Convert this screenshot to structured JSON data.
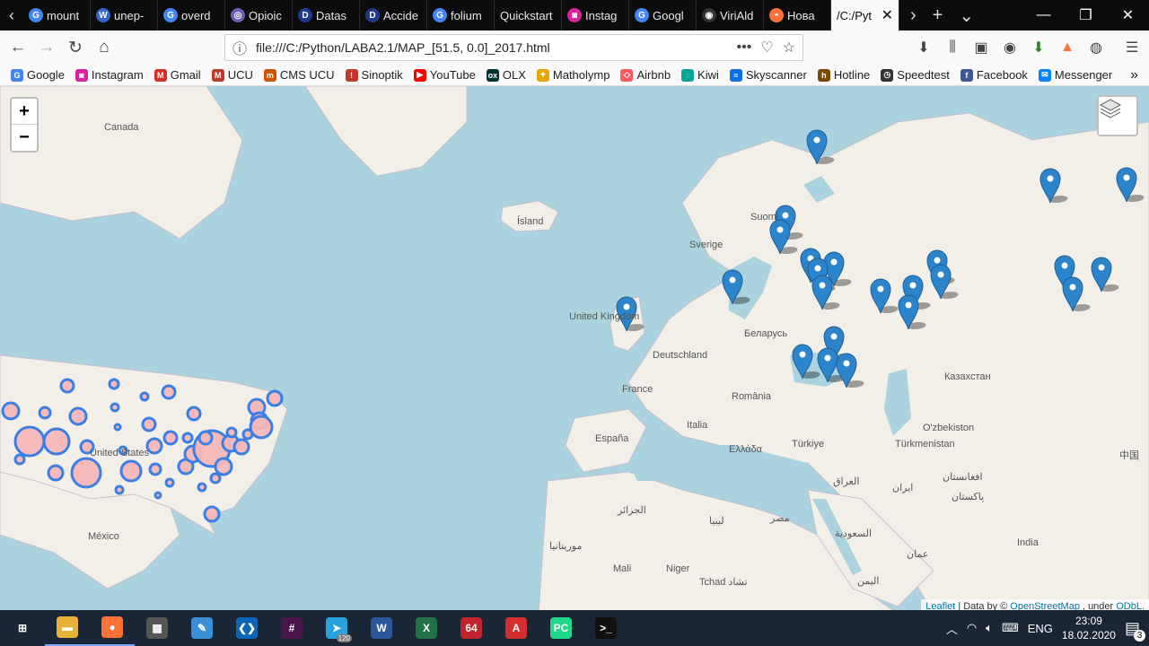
{
  "tabs": [
    {
      "icon": "G",
      "color": "#4285f4",
      "label": "mount"
    },
    {
      "icon": "W",
      "color": "#3366cc",
      "label": "unep-"
    },
    {
      "icon": "G",
      "color": "#4285f4",
      "label": "overd"
    },
    {
      "icon": "◎",
      "color": "#6b5fb5",
      "label": "Opioic"
    },
    {
      "icon": "D",
      "color": "#1f3a8a",
      "label": "Datas"
    },
    {
      "icon": "D",
      "color": "#1f3a8a",
      "label": "Accide"
    },
    {
      "icon": "G",
      "color": "#4285f4",
      "label": "folium"
    },
    {
      "icon": "",
      "color": "#0c0c0d",
      "label": "Quickstart"
    },
    {
      "icon": "◙",
      "color": "#d6249f",
      "label": "Instag"
    },
    {
      "icon": "G",
      "color": "#4285f4",
      "label": "Googl"
    },
    {
      "icon": "◉",
      "color": "#333",
      "label": "ViriAld"
    },
    {
      "icon": "◓",
      "color": "#ff7139",
      "label": "Нова"
    }
  ],
  "active_tab": {
    "label": "/C:/Pyt"
  },
  "url": "file:///C:/Python/LABA2.1/MAP_[51.5, 0.0]_2017.html",
  "bookmarks": [
    {
      "icon": "G",
      "color": "#4285f4",
      "label": "Google"
    },
    {
      "icon": "◙",
      "color": "#d6249f",
      "label": "Instagram"
    },
    {
      "icon": "M",
      "color": "#d93025",
      "label": "Gmail"
    },
    {
      "icon": "M",
      "color": "#c0392b",
      "label": "UCU"
    },
    {
      "icon": "m",
      "color": "#d35400",
      "label": "CMS UCU"
    },
    {
      "icon": "!",
      "color": "#c0392b",
      "label": "Sinoptik"
    },
    {
      "icon": "▶",
      "color": "#ff0000",
      "label": "YouTube"
    },
    {
      "icon": "ox",
      "color": "#002f34",
      "label": "OLX"
    },
    {
      "icon": "✦",
      "color": "#e6a800",
      "label": "Matholymp"
    },
    {
      "icon": "◇",
      "color": "#ff5a5f",
      "label": "Airbnb"
    },
    {
      "icon": "◌",
      "color": "#00a698",
      "label": "Kiwi"
    },
    {
      "icon": "≈",
      "color": "#0770e3",
      "label": "Skyscanner"
    },
    {
      "icon": "h",
      "color": "#7a4a00",
      "label": "Hotline"
    },
    {
      "icon": "◷",
      "color": "#333",
      "label": "Speedtest"
    },
    {
      "icon": "f",
      "color": "#3b5998",
      "label": "Facebook"
    },
    {
      "icon": "✉",
      "color": "#0084ff",
      "label": "Messenger"
    }
  ],
  "map": {
    "labels": [
      {
        "text": "Canada"
      },
      {
        "text": "Ísland"
      },
      {
        "text": "Suomi"
      },
      {
        "text": "Sverige"
      },
      {
        "text": "United Kingdom"
      },
      {
        "text": "Deutschland"
      },
      {
        "text": "Беларусь"
      },
      {
        "text": "France"
      },
      {
        "text": "România"
      },
      {
        "text": "Italia"
      },
      {
        "text": "España"
      },
      {
        "text": "Ελλάδα"
      },
      {
        "text": "Türkiye"
      },
      {
        "text": "Казахстан"
      },
      {
        "text": "O'zbekiston"
      },
      {
        "text": "Türkmenistan"
      },
      {
        "text": "United States"
      },
      {
        "text": "México"
      },
      {
        "text": "العراق"
      },
      {
        "text": "ایران"
      },
      {
        "text": "افغانستان"
      },
      {
        "text": "پاکستان"
      },
      {
        "text": "India"
      },
      {
        "text": "中国"
      },
      {
        "text": "الجزائر"
      },
      {
        "text": "ليبيا"
      },
      {
        "text": "مصر"
      },
      {
        "text": "السعودية"
      },
      {
        "text": "عمان"
      },
      {
        "text": "اليمن"
      },
      {
        "text": "Mali"
      },
      {
        "text": "Niger"
      },
      {
        "text": "Tchad تشاد"
      },
      {
        "text": "موريتانيا"
      }
    ],
    "zoom_in": "+",
    "zoom_out": "−",
    "attribution": {
      "leaflet": "Leaflet",
      "sep": "| Data by ©",
      "osm": "OpenStreetMap",
      "under": ", under",
      "odbl": "ODbL."
    }
  },
  "taskbar": {
    "apps": [
      {
        "name": "start-button",
        "glyph": "⊞",
        "color": "#1a2535"
      },
      {
        "name": "explorer-app",
        "glyph": "▬",
        "color": "#e8b23a"
      },
      {
        "name": "firefox-app",
        "glyph": "●",
        "color": "#ff7139"
      },
      {
        "name": "calculator-app",
        "glyph": "▦",
        "color": "#555"
      },
      {
        "name": "paint-app",
        "glyph": "✎",
        "color": "#3a8fd6"
      },
      {
        "name": "vscode-app",
        "glyph": "❮❯",
        "color": "#0a66b8"
      },
      {
        "name": "slack-app",
        "glyph": "#",
        "color": "#4a154b"
      },
      {
        "name": "telegram-app",
        "glyph": "➤",
        "color": "#2aa3dd"
      },
      {
        "name": "word-app",
        "glyph": "W",
        "color": "#2b579a"
      },
      {
        "name": "excel-app",
        "glyph": "X",
        "color": "#217346"
      },
      {
        "name": "aida64-app",
        "glyph": "64",
        "color": "#c0252d"
      },
      {
        "name": "acrobat-app",
        "glyph": "A",
        "color": "#d32f2f"
      },
      {
        "name": "pycharm-app",
        "glyph": "PC",
        "color": "#21d789"
      },
      {
        "name": "terminal-app",
        "glyph": ">_",
        "color": "#111"
      }
    ],
    "telegram_badge": "120",
    "lang": "ENG",
    "time": "23:09",
    "date": "18.02.2020",
    "notif_count": "3"
  }
}
